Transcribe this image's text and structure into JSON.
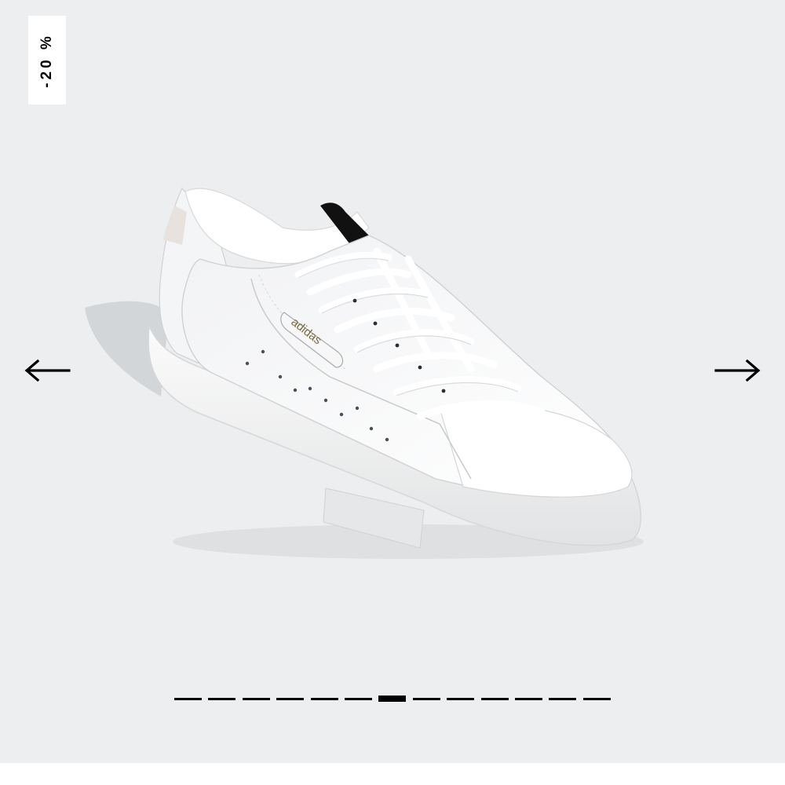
{
  "badge": {
    "text": "-20 %"
  },
  "colors": {
    "background": "#eceeef",
    "badge_bg": "#ffffff",
    "ink": "#000000"
  },
  "icons": {
    "prev": "arrow-left-icon",
    "next": "arrow-right-icon"
  },
  "product_image": {
    "brand_text": "adidas"
  },
  "carousel": {
    "total_slides": 13,
    "active_index": 6
  }
}
